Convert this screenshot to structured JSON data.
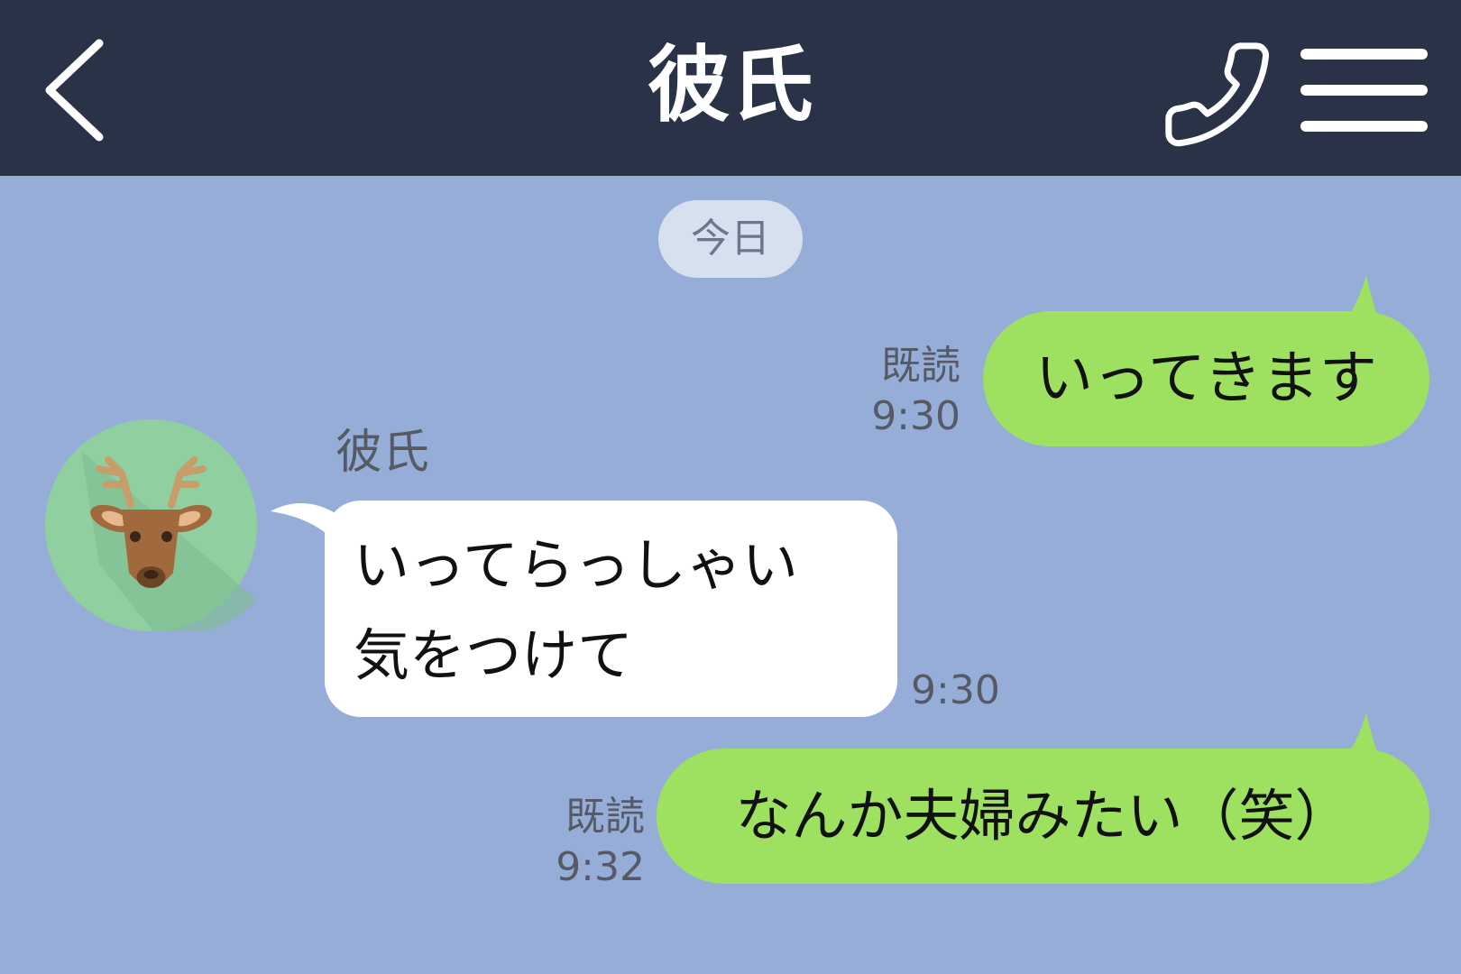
{
  "header": {
    "title": "彼氏",
    "back_icon": "back-icon",
    "call_icon": "phone-icon",
    "menu_icon": "menu-icon"
  },
  "date_separator": "今日",
  "messages": [
    {
      "side": "sent",
      "text": "いってきます",
      "read_label": "既読",
      "time": "9:30"
    },
    {
      "side": "received",
      "sender": "彼氏",
      "lines": [
        "いってらっしゃい",
        "気をつけて"
      ],
      "time": "9:30"
    },
    {
      "side": "sent",
      "text": "なんか夫婦みたい（笑）",
      "read_label": "既読",
      "time": "9:32"
    }
  ],
  "colors": {
    "header_bg": "#293246",
    "chat_bg": "#96aed7",
    "sent_bubble": "#9ee060",
    "received_bubble": "#ffffff",
    "date_pill": "#d7e0ee",
    "avatar_bg": "#8fcfa0"
  },
  "avatar_icon": "deer-icon"
}
